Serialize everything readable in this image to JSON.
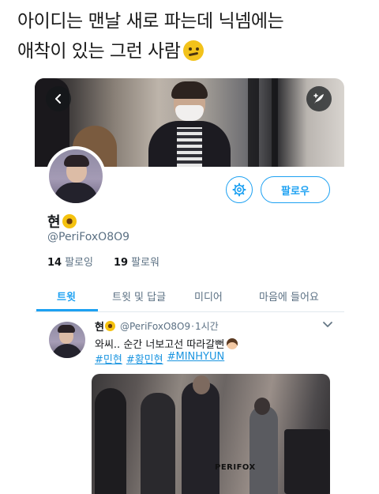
{
  "caption": {
    "line1": "아이디는 맨날 새로 파는데 닉넴에는",
    "line2": "애착이 있는 그런 사람",
    "emoji": "thinking-face-emoji"
  },
  "profile": {
    "display_name": "현",
    "handle": "@PeriFoxO8O9",
    "following_count": "14",
    "following_label": "팔로잉",
    "followers_count": "19",
    "followers_label": "팔로워",
    "follow_button": "팔로우",
    "badge_emoji": "sunflower-emoji"
  },
  "tabs": [
    {
      "label": "트윗",
      "active": true
    },
    {
      "label": "트윗 및 답글",
      "active": false
    },
    {
      "label": "미디어",
      "active": false
    },
    {
      "label": "마음에 들어요",
      "active": false
    }
  ],
  "tweet": {
    "author": "현",
    "handle": "@PeriFoxO8O9",
    "separator": "·",
    "time": "1시간",
    "text": "와씨.. 순간 너보고선 따라갈뻔",
    "hashtags": [
      "#민현",
      "#황민현",
      "#MINHYUN"
    ],
    "media_watermark": "PERIFOX"
  },
  "colors": {
    "accent": "#1da1f2",
    "secondary_text": "#5b7083"
  }
}
